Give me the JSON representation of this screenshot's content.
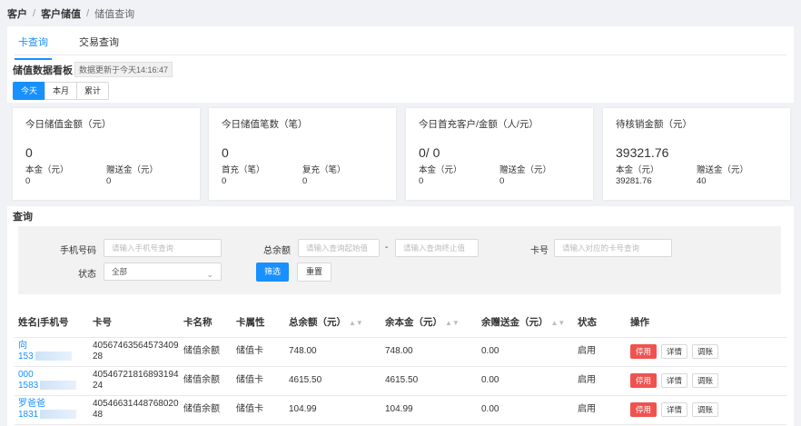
{
  "breadcrumb": {
    "item1": "客户",
    "item2": "客户储值",
    "item3": "储值查询",
    "sep": "/"
  },
  "tabs": [
    {
      "label": "卡查询"
    },
    {
      "label": "交易查询"
    }
  ],
  "board": {
    "title": "储值数据看板",
    "note": "数据更新于今天14:16:47"
  },
  "periods": [
    {
      "label": "今天"
    },
    {
      "label": "本月"
    },
    {
      "label": "累计"
    }
  ],
  "stats": [
    {
      "title": "今日储值金额（元）",
      "value": "0",
      "l1": "本金（元）",
      "v1": "0",
      "l2": "赠送金（元）",
      "v2": "0"
    },
    {
      "title": "今日储值笔数（笔）",
      "value": "0",
      "l1": "首充（笔）",
      "v1": "0",
      "l2": "复充（笔）",
      "v2": "0"
    },
    {
      "title": "今日首充客户/金额（人/元）",
      "value": "0/ 0",
      "l1": "本金（元）",
      "v1": "0",
      "l2": "赠送金（元）",
      "v2": "0"
    },
    {
      "title": "待核销金额（元）",
      "value": "39321.76",
      "l1": "本金（元）",
      "v1": "39281.76",
      "l2": "赠送金（元）",
      "v2": "40"
    }
  ],
  "query": {
    "title": "查询",
    "phone_label": "手机号码",
    "phone_placeholder": "请输入手机号查询",
    "total_label": "总余额",
    "total_min_placeholder": "请输入查询起始值",
    "dash": "-",
    "total_max_placeholder": "请输入查询终止值",
    "card_label": "卡号",
    "card_placeholder": "请输入对应的卡号查询",
    "status_label": "状态",
    "status_value": "全部",
    "filter_button": "筛选",
    "reset_button": "重置"
  },
  "table": {
    "headers": [
      "姓名|手机号",
      "卡号",
      "卡名称",
      "卡属性",
      "总余额（元）",
      "余本金（元）",
      "余赠送金（元）",
      "状态",
      "操作"
    ],
    "rows": [
      {
        "name": "向",
        "phone": "153",
        "card_no_1": "40567463564573409",
        "card_no_2": "28",
        "card_name": "储值余额",
        "card_type": "储值卡",
        "total": "748.00",
        "principal": "748.00",
        "gift": "0.00",
        "status": "启用"
      },
      {
        "name": "000",
        "phone": "1583",
        "card_no_1": "40546721816893194",
        "card_no_2": "24",
        "card_name": "储值余额",
        "card_type": "储值卡",
        "total": "4615.50",
        "principal": "4615.50",
        "gift": "0.00",
        "status": "启用"
      },
      {
        "name": "罗爸爸",
        "phone": "1831",
        "card_no_1": "40546631448768020",
        "card_no_2": "48",
        "card_name": "储值余额",
        "card_type": "储值卡",
        "total": "104.99",
        "principal": "104.99",
        "gift": "0.00",
        "status": "启用"
      }
    ],
    "actions": {
      "disable": "停用",
      "detail": "详情",
      "adjust": "调账"
    }
  },
  "colors": {
    "primary": "#1890ff",
    "danger": "#ef5350",
    "background": "#f0f2f5"
  },
  "icons": {
    "select_caret": "chevron-down-icon",
    "sort": "sort-icon"
  }
}
